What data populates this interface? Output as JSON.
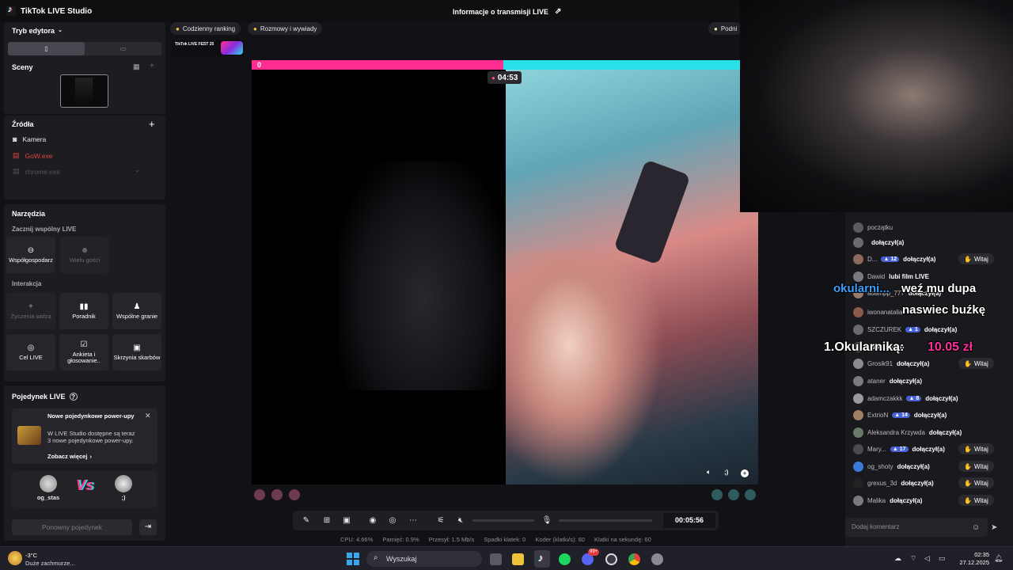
{
  "window": {
    "title": "TikTok LIVE Studio",
    "stream_info_label": "Informacje o transmisji LIVE"
  },
  "left_panel": {
    "editor_mode_label": "Tryb edytora",
    "scenes_header": "Sceny",
    "sources_header": "Źródła",
    "sources": [
      "Kamera",
      "GoW.exe",
      "chrome.exe"
    ],
    "tools_header": "Narzędzia",
    "start_joint_live_label": "Zacznij wspólny LIVE",
    "cohost_label": "Współgospodarz",
    "multi_guest_label": "Wielu gości",
    "interaction_label": "Interakcja",
    "interaction_tiles": [
      "Życzenia widza",
      "Poradnik",
      "Wspólne granie",
      "Cel LIVE",
      "Ankieta i głosowanie..",
      "Skrzynia skarbów"
    ],
    "battle_header": "Pojedynek LIVE",
    "promo_title": "Nowe pojedynkowe power-upy",
    "promo_text": "W LIVE Studio dostępne są teraz 3 nowe pojedynkowe power-upy.",
    "promo_link": "Zobacz więcej",
    "player_left": "og_stas",
    "vs_label": "Vs",
    "player_right": ";)",
    "rematch_button": "Ponowny pojedynek"
  },
  "top_pills": [
    "Codzienny ranking",
    "Rozmowy i wywiady",
    "Podni"
  ],
  "live_fest_label": "TikTok LIVE FEST 25",
  "battle": {
    "score_left": "0",
    "timer": "04:53",
    "right_name": ";)"
  },
  "overlays": {
    "text_blue": "okularni...",
    "text_white1": "weź mu dupa",
    "text_white2": "naswiec buźkę",
    "ranking_prefix": "1.Okularniką:",
    "ranking_value": "10.05 zł"
  },
  "chat": {
    "witaj_label": "Witaj",
    "joined_label": "dołączył(a)",
    "rows": [
      {
        "name": "początku",
        "badge": "",
        "action": "",
        "witaj": false
      },
      {
        "name": "",
        "badge": "",
        "action": "dołączył(a)",
        "witaj": false
      },
      {
        "name": "D...",
        "badge": "12",
        "action": "dołączył(a)",
        "witaj": true
      },
      {
        "name": "Dawid",
        "badge": "",
        "action": "lubi film LIVE",
        "witaj": false
      },
      {
        "name": "adampp_777",
        "badge": "",
        "action": "dołączył(a)",
        "witaj": false
      },
      {
        "name": "iwonanatalia",
        "badge": "",
        "action": "",
        "witaj": false
      },
      {
        "name": "SZCZUREK",
        "badge": "1",
        "action": "dołączył(a)",
        "witaj": false
      },
      {
        "name": "",
        "badge": "",
        "action": "dołączył(a)",
        "witaj": false
      },
      {
        "name": "Grosik91",
        "badge": "",
        "action": "dołączył(a)",
        "witaj": true
      },
      {
        "name": "ataner",
        "badge": "",
        "action": "dołączył(a)",
        "witaj": false
      },
      {
        "name": "adamczakkk",
        "badge": "8",
        "action": "dołączył(a)",
        "witaj": false
      },
      {
        "name": "ExtrioN",
        "badge": "14",
        "action": "dołączył(a)",
        "witaj": false
      },
      {
        "name": "Aleksandra Krzywda",
        "badge": "",
        "action": "dołączył(a)",
        "witaj": false
      },
      {
        "name": "Mary...",
        "badge": "17",
        "action": "dołączył(a)",
        "witaj": true
      },
      {
        "name": "og_shoty",
        "badge": "",
        "action": "dołączył(a)",
        "witaj": true
      },
      {
        "name": "grexus_3d",
        "badge": "",
        "action": "dołączył(a)",
        "witaj": true
      },
      {
        "name": "Malika",
        "badge": "",
        "action": "dołączył(a)",
        "witaj": true
      }
    ],
    "comment_placeholder": "Dodaj komentarz"
  },
  "controls": {
    "elapsed": "00:05:56"
  },
  "stats": [
    "CPU:  4.66%",
    "Pamięć:  0.9%",
    "Przesył:  1.5 Mb/s",
    "Spadki klatek:  0",
    "Koder (klatki/s):  60",
    "Klatki na sekundę:  60"
  ],
  "taskbar": {
    "weather_temp": "-3°C",
    "weather_desc": "Duże zachmurze...",
    "search_label": "Wyszukaj",
    "time": "02:35",
    "date": "27.12.2025",
    "discord_badge": "99+"
  }
}
